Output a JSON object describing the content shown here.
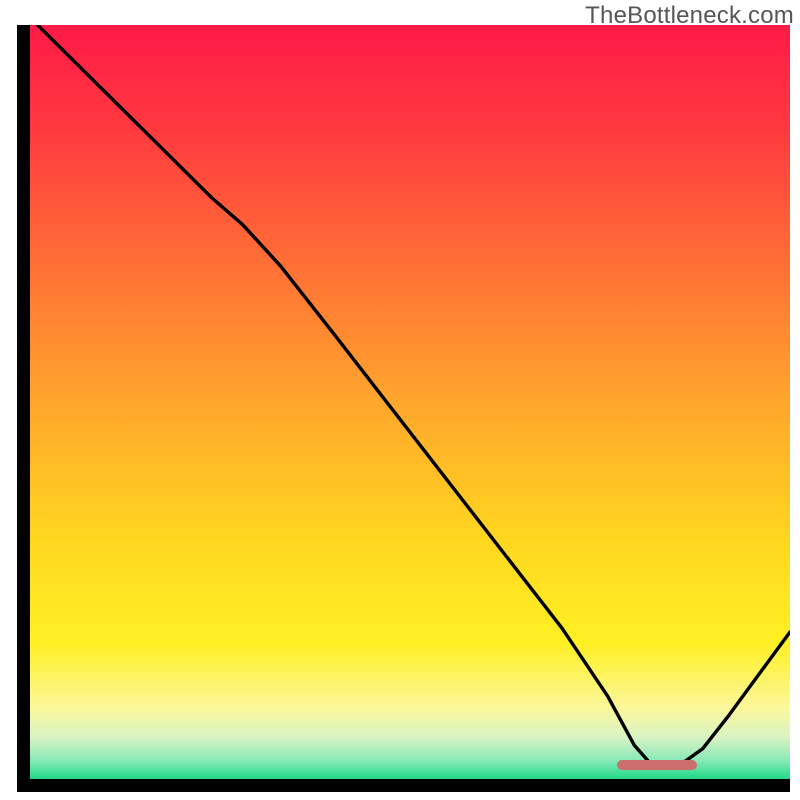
{
  "watermark": "TheBottleneck.com",
  "plot": {
    "inner_width": 760,
    "inner_height": 754
  },
  "gradient_stops": [
    {
      "offset": 0,
      "color": "#ff1a47"
    },
    {
      "offset": 0.14,
      "color": "#ff3a3f"
    },
    {
      "offset": 0.3,
      "color": "#ff6a36"
    },
    {
      "offset": 0.5,
      "color": "#ffa62c"
    },
    {
      "offset": 0.68,
      "color": "#ffd61f"
    },
    {
      "offset": 0.82,
      "color": "#fff024"
    },
    {
      "offset": 0.905,
      "color": "#fbf79a"
    },
    {
      "offset": 0.945,
      "color": "#d9f3c4"
    },
    {
      "offset": 0.975,
      "color": "#89e9b6"
    },
    {
      "offset": 1.0,
      "color": "#21d988"
    }
  ],
  "marker": {
    "x_frac_start": 0.772,
    "x_frac_end": 0.878,
    "y_frac": 0.982,
    "color": "#cc6e6d"
  },
  "chart_data": {
    "type": "line",
    "title": "",
    "xlabel": "",
    "ylabel": "",
    "note": "Axis tick labels are not rendered in the source image; values below are normalized to [0,1] as sampled from the plotted curve (x ≈ position left→right, y ≈ value bottom→top). The red pill at the bottom marks the minimum region.",
    "x_range_fraction": [
      0.0,
      1.0
    ],
    "y_range_fraction": [
      0.0,
      1.0
    ],
    "series": [
      {
        "name": "curve",
        "points": [
          {
            "x": 0.01,
            "y": 1.0
          },
          {
            "x": 0.08,
            "y": 0.93
          },
          {
            "x": 0.16,
            "y": 0.85
          },
          {
            "x": 0.24,
            "y": 0.77
          },
          {
            "x": 0.28,
            "y": 0.735
          },
          {
            "x": 0.33,
            "y": 0.68
          },
          {
            "x": 0.4,
            "y": 0.59
          },
          {
            "x": 0.5,
            "y": 0.46
          },
          {
            "x": 0.6,
            "y": 0.33
          },
          {
            "x": 0.7,
            "y": 0.2
          },
          {
            "x": 0.76,
            "y": 0.11
          },
          {
            "x": 0.795,
            "y": 0.045
          },
          {
            "x": 0.815,
            "y": 0.022
          },
          {
            "x": 0.83,
            "y": 0.018
          },
          {
            "x": 0.86,
            "y": 0.022
          },
          {
            "x": 0.885,
            "y": 0.04
          },
          {
            "x": 0.92,
            "y": 0.085
          },
          {
            "x": 0.96,
            "y": 0.14
          },
          {
            "x": 1.0,
            "y": 0.195
          }
        ]
      }
    ],
    "annotations": [
      {
        "name": "minimum-marker",
        "shape": "rounded-bar",
        "x_start_frac": 0.772,
        "x_end_frac": 0.878,
        "y_frac": 0.018,
        "color": "#cc6e6d"
      }
    ]
  }
}
